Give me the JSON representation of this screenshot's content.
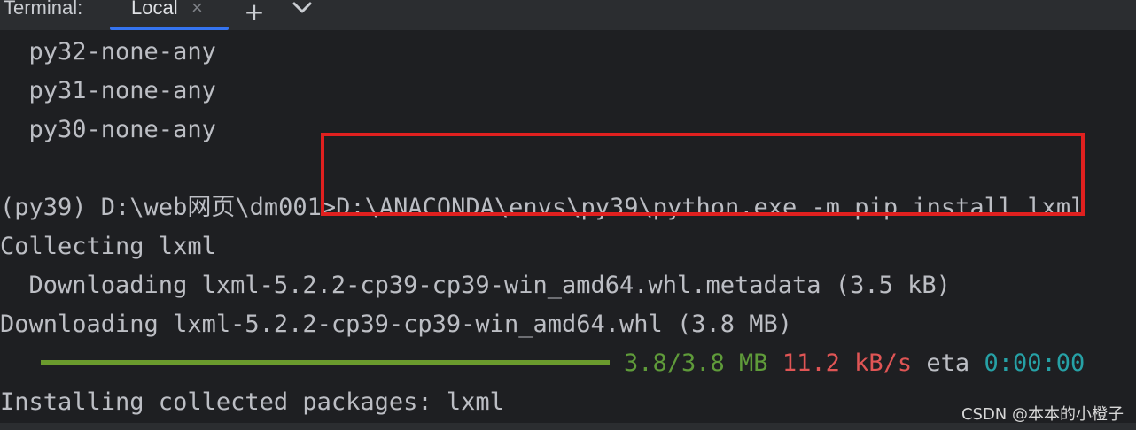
{
  "header": {
    "title": "Terminal:",
    "tabs": [
      {
        "label": "Local",
        "close_glyph": "×",
        "active": true
      }
    ],
    "add_glyph": "+",
    "icons": [
      "close-icon",
      "plus-icon",
      "chevron-down-icon"
    ]
  },
  "terminal": {
    "lines": {
      "l1": "  py32-none-any",
      "l2": "  py31-none-any",
      "l3": "  py30-none-any",
      "prompt": "(py39) D:\\web网页\\dm001>",
      "command": "D:\\ANACONDA\\envs\\py39\\python.exe -m pip install lxml",
      "l5": "Collecting lxml",
      "l6": "  Downloading lxml-5.2.2-cp39-cp39-win_amd64.whl.metadata (3.5 kB)",
      "l7": "Downloading lxml-5.2.2-cp39-cp39-win_amd64.whl (3.8 MB)",
      "l9": "Installing collected packages: lxml"
    },
    "progress": {
      "fraction": 1.0,
      "size": "3.8/3.8 MB",
      "rate": "11.2 kB/s",
      "eta_label": "eta",
      "eta_value": "0:00:00"
    },
    "colors": {
      "background": "#1e1f22",
      "text": "#bcbec4",
      "progress_green": "#6a9a2d",
      "size_green": "#5f9b3a",
      "rate_red": "#e05555",
      "eta_cyan": "#26a1a6",
      "highlight_red": "#e0201f",
      "tab_underline": "#3574f0"
    }
  },
  "watermark": "CSDN @本本的小橙子"
}
